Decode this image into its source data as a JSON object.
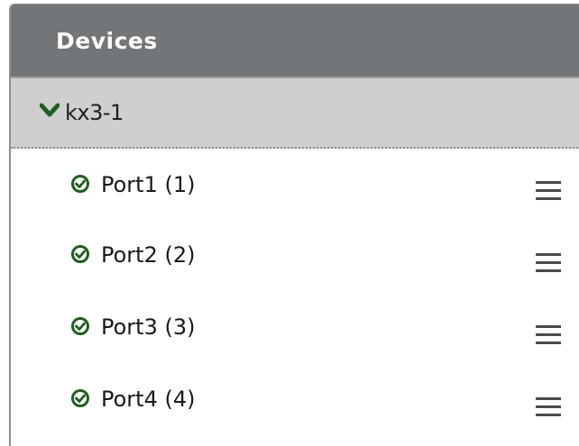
{
  "panel": {
    "title": "Devices"
  },
  "device": {
    "name": "kx3-1",
    "expand_icon": "chevron-down-icon",
    "accent_color": "#1e5e1e"
  },
  "ports": [
    {
      "label": "Port1 (1)",
      "status_icon": "check-circle-icon",
      "menu_icon": "hamburger-menu-icon"
    },
    {
      "label": "Port2 (2)",
      "status_icon": "check-circle-icon",
      "menu_icon": "hamburger-menu-icon"
    },
    {
      "label": "Port3 (3)",
      "status_icon": "check-circle-icon",
      "menu_icon": "hamburger-menu-icon"
    },
    {
      "label": "Port4 (4)",
      "status_icon": "check-circle-icon",
      "menu_icon": "hamburger-menu-icon"
    }
  ]
}
